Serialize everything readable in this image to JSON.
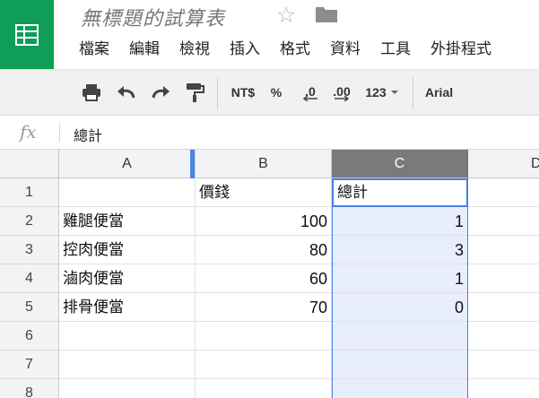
{
  "app": {
    "doc_title": "無標題的試算表"
  },
  "menubar": {
    "items": [
      "檔案",
      "編輯",
      "檢視",
      "插入",
      "格式",
      "資料",
      "工具",
      "外掛程式"
    ]
  },
  "toolbar": {
    "currency_label": "NT$",
    "percent_label": "%",
    "decrease_decimal_label": ".0",
    "increase_decimal_label": ".00",
    "more_formats_label": "123",
    "font_label": "Arial"
  },
  "formula_bar": {
    "fx_label": "fx",
    "value": "總計"
  },
  "sheet": {
    "column_headers": [
      "A",
      "B",
      "C",
      "D"
    ],
    "row_headers": [
      "1",
      "2",
      "3",
      "4",
      "5",
      "6",
      "7",
      "8"
    ],
    "cells": {
      "A2": "雞腿便當",
      "A3": "控肉便當",
      "A4": "滷肉便當",
      "A5": "排骨便當",
      "B1": "價錢",
      "B2": "100",
      "B3": "80",
      "B4": "60",
      "B5": "70",
      "C1": "總計",
      "C2": "1",
      "C3": "3",
      "C4": "1",
      "C5": "0"
    },
    "selected_column": "C",
    "active_cell": "C1"
  },
  "colors": {
    "brand": "#0f9d58",
    "selection": "#4a7de2",
    "selected_column_fill": "#e8eefb"
  }
}
